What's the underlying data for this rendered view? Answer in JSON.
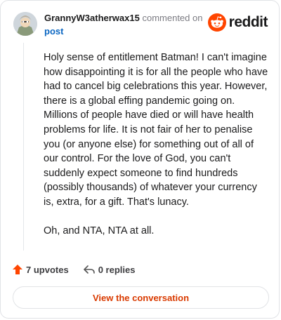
{
  "header": {
    "username": "GrannyW3atherwax15",
    "action_text": "commented on",
    "post_label": "post",
    "logo_text": "reddit"
  },
  "comment": {
    "paragraphs": [
      "Holy sense of entitlement Batman! I can't imagine how disappointing it is for all the people who have had to cancel big celebrations this year. However, there is a global effing pandemic going on. Millions of people have died or will have health problems for life. It is not fair of her to penalise you (or anyone else) for something out of all of our control. For the love of God, you can't suddenly expect someone to find hundreds (possibly thousands) of whatever your currency is, extra, for a gift. That's lunacy.",
      "Oh, and NTA, NTA at all."
    ]
  },
  "actions": {
    "upvotes": "7 upvotes",
    "replies": "0 replies"
  },
  "footer": {
    "view_button": "View the conversation"
  },
  "colors": {
    "brand": "#ff4500",
    "link": "#0a66c2",
    "button_text": "#d93a00"
  },
  "icons": [
    "avatar",
    "reddit-logo-icon",
    "upvote-icon",
    "reply-icon"
  ]
}
